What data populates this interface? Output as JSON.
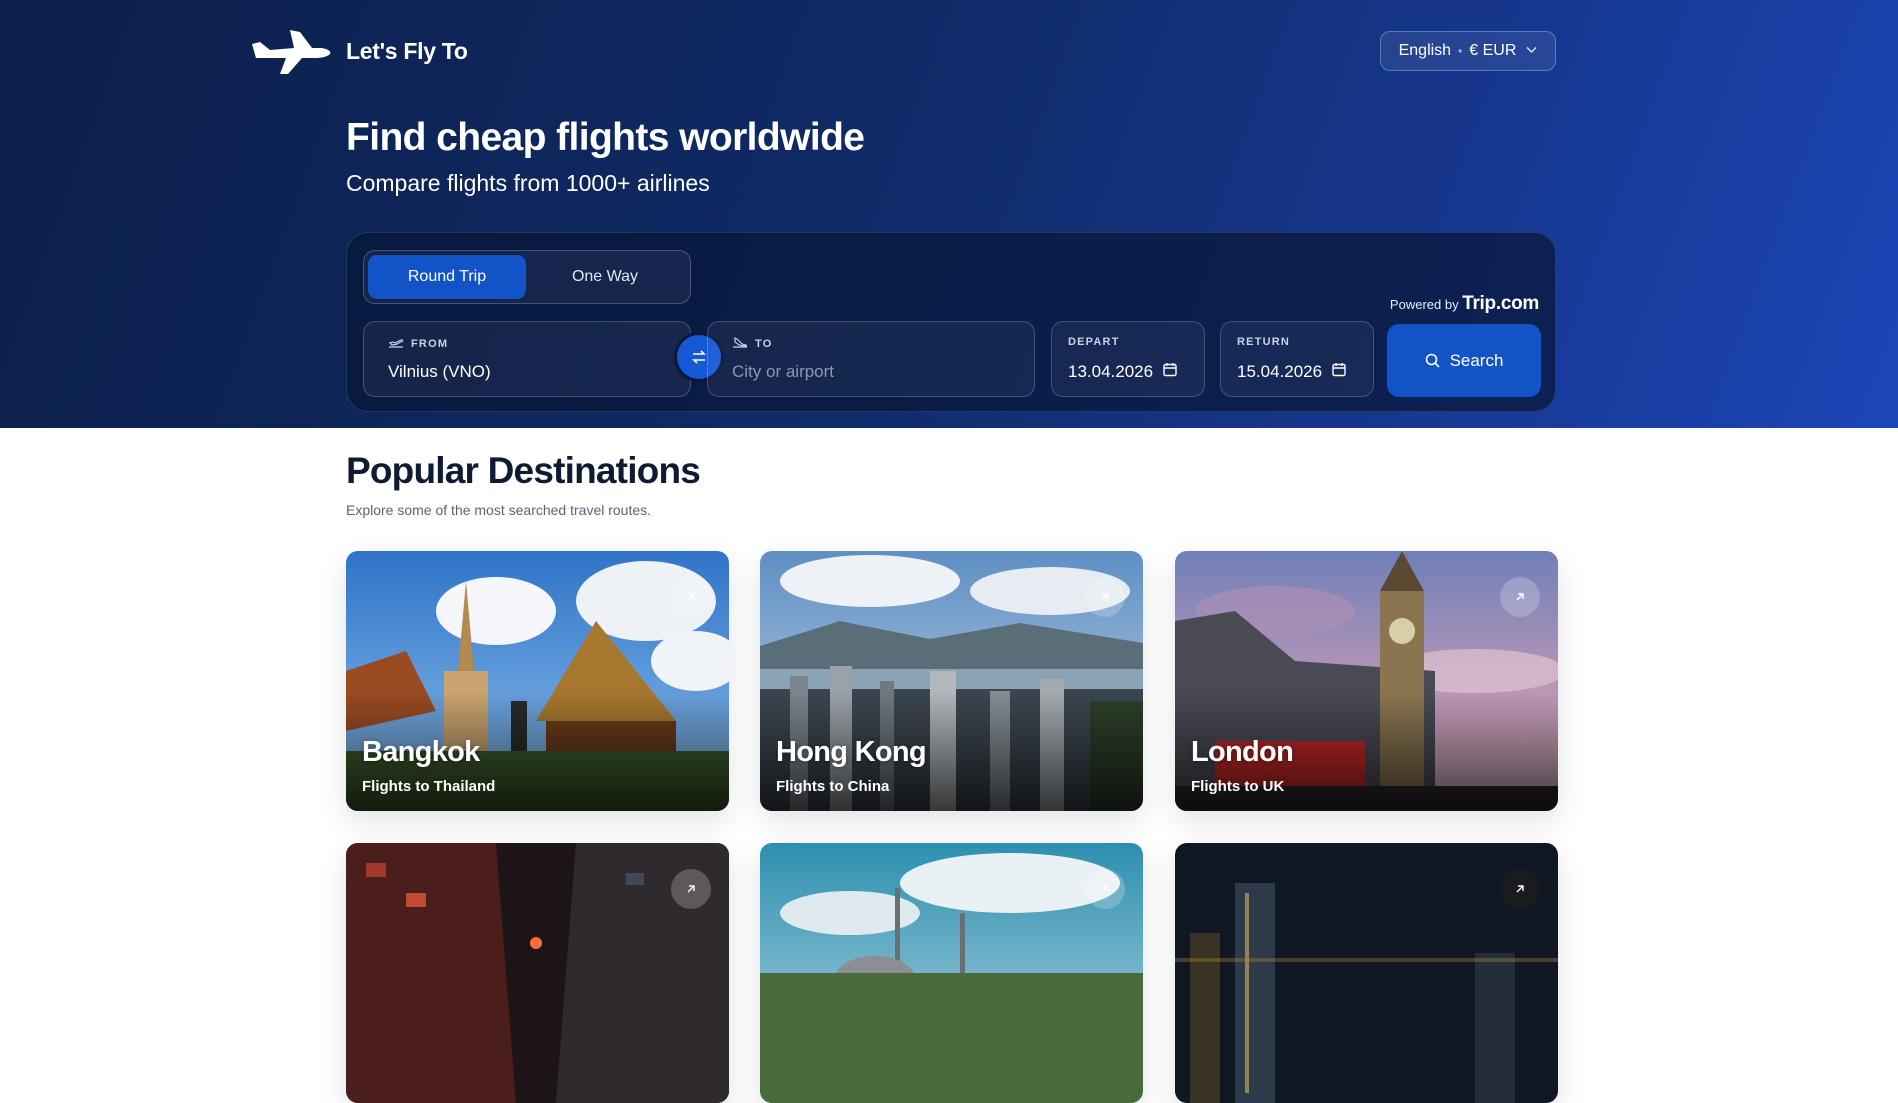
{
  "header": {
    "brand": "Let's Fly To",
    "language": "English",
    "currency": "€ EUR"
  },
  "hero": {
    "title": "Find cheap flights worldwide",
    "subtitle": "Compare flights from 1000+ airlines"
  },
  "search": {
    "trip_types": [
      "Round Trip",
      "One Way"
    ],
    "selected_trip_type": "Round Trip",
    "powered_prefix": "Powered by",
    "powered_brand": "Trip.com",
    "from": {
      "label": "FROM",
      "value": "Vilnius (VNO)"
    },
    "to": {
      "label": "TO",
      "placeholder": "City or airport",
      "value": ""
    },
    "depart": {
      "label": "DEPART",
      "value": "13.04.2026"
    },
    "return": {
      "label": "RETURN",
      "value": "15.04.2026"
    },
    "search_label": "Search"
  },
  "popular": {
    "title": "Popular Destinations",
    "subtitle": "Explore some of the most searched travel routes.",
    "cards": [
      {
        "city": "Bangkok",
        "subtitle": "Flights to Thailand"
      },
      {
        "city": "Hong Kong",
        "subtitle": "Flights to China"
      },
      {
        "city": "London",
        "subtitle": "Flights to UK"
      },
      {
        "city": "",
        "subtitle": ""
      },
      {
        "city": "",
        "subtitle": ""
      },
      {
        "city": "",
        "subtitle": ""
      }
    ]
  },
  "colors": {
    "hero_dark": "#0c1f4a",
    "hero_light": "#1c46b8",
    "accent": "#1253c8",
    "heading": "#0f1b33"
  },
  "icons": [
    "plane-logo-icon",
    "chevron-down-icon",
    "takeoff-icon",
    "landing-icon",
    "swap-icon",
    "calendar-icon",
    "search-icon",
    "arrow-up-right-icon"
  ]
}
